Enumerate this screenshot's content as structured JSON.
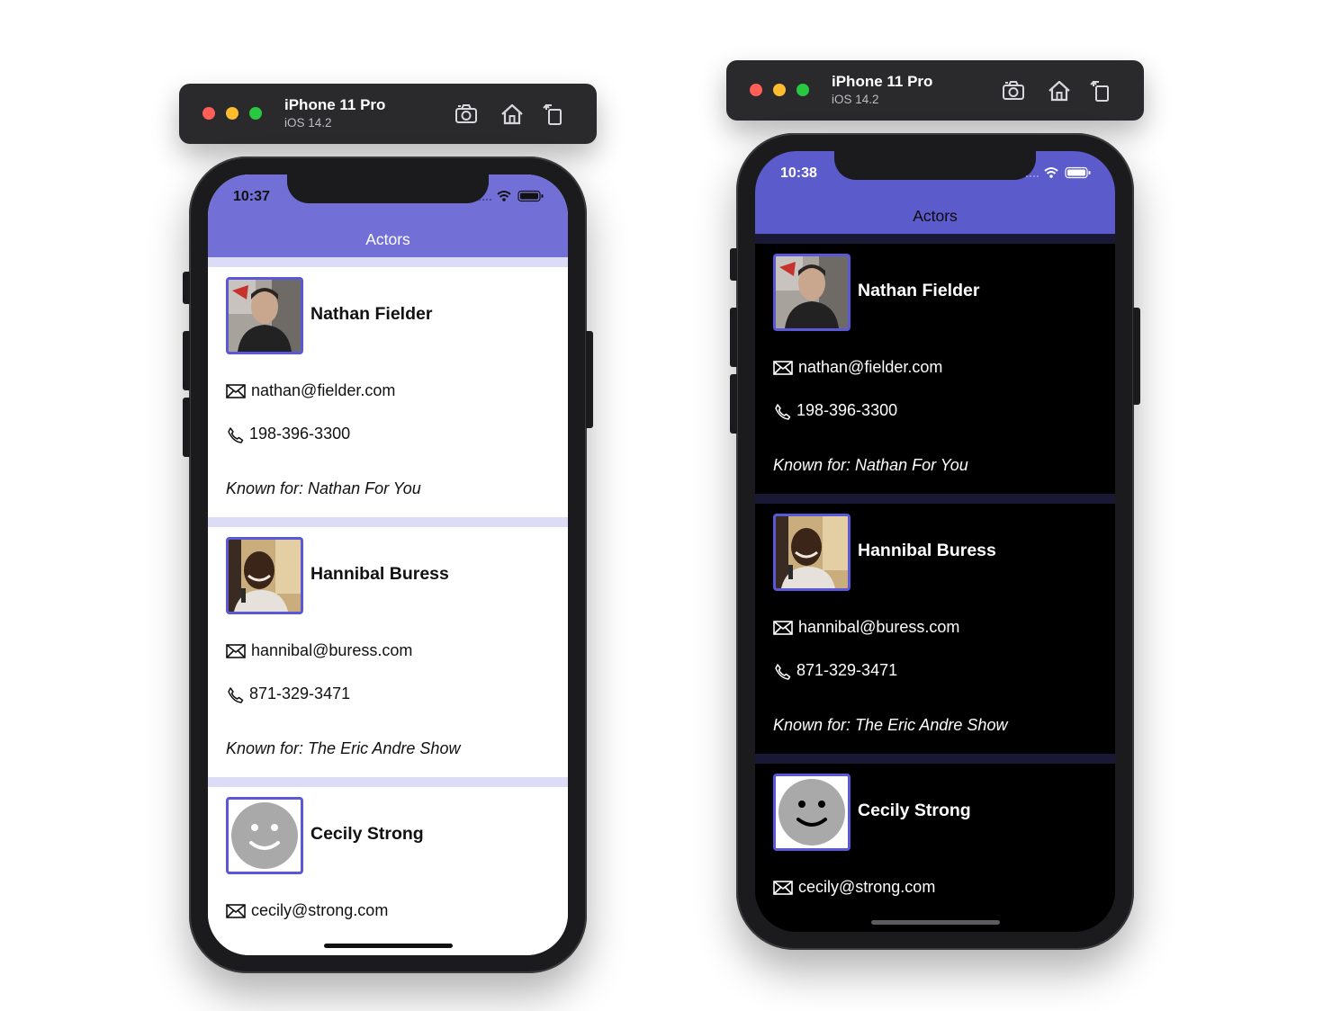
{
  "simulator": {
    "device_name": "iPhone 11 Pro",
    "os_version": "iOS 14.2",
    "toolbar_icons": [
      "screenshot-icon",
      "home-icon",
      "rotate-icon"
    ]
  },
  "screens": [
    {
      "mode": "light",
      "time": "10:37",
      "nav_title": "Actors",
      "actors": [
        {
          "name": "Nathan Fielder",
          "email": "nathan@fielder.com",
          "phone": "198-396-3300",
          "known_for": "Known for: Nathan For You",
          "photo": "photo"
        },
        {
          "name": "Hannibal Buress",
          "email": "hannibal@buress.com",
          "phone": "871-329-3471",
          "known_for": "Known for: The Eric Andre Show",
          "photo": "photo"
        },
        {
          "name": "Cecily Strong",
          "email": "cecily@strong.com",
          "photo": "placeholder-smiley"
        }
      ]
    },
    {
      "mode": "dark",
      "time": "10:38",
      "nav_title": "Actors",
      "actors": [
        {
          "name": "Nathan Fielder",
          "email": "nathan@fielder.com",
          "phone": "198-396-3300",
          "known_for": "Known for: Nathan For You",
          "photo": "photo"
        },
        {
          "name": "Hannibal Buress",
          "email": "hannibal@buress.com",
          "phone": "871-329-3471",
          "known_for": "Known for: The Eric Andre Show",
          "photo": "photo"
        },
        {
          "name": "Cecily Strong",
          "email": "cecily@strong.com",
          "photo": "placeholder-smiley"
        }
      ]
    }
  ],
  "colors": {
    "nav_light": "#7270d6",
    "nav_dark": "#5c5bcb",
    "avatar_border": "#5a58d6",
    "separator_light": "#dcdcf6",
    "separator_dark": "#191936"
  }
}
